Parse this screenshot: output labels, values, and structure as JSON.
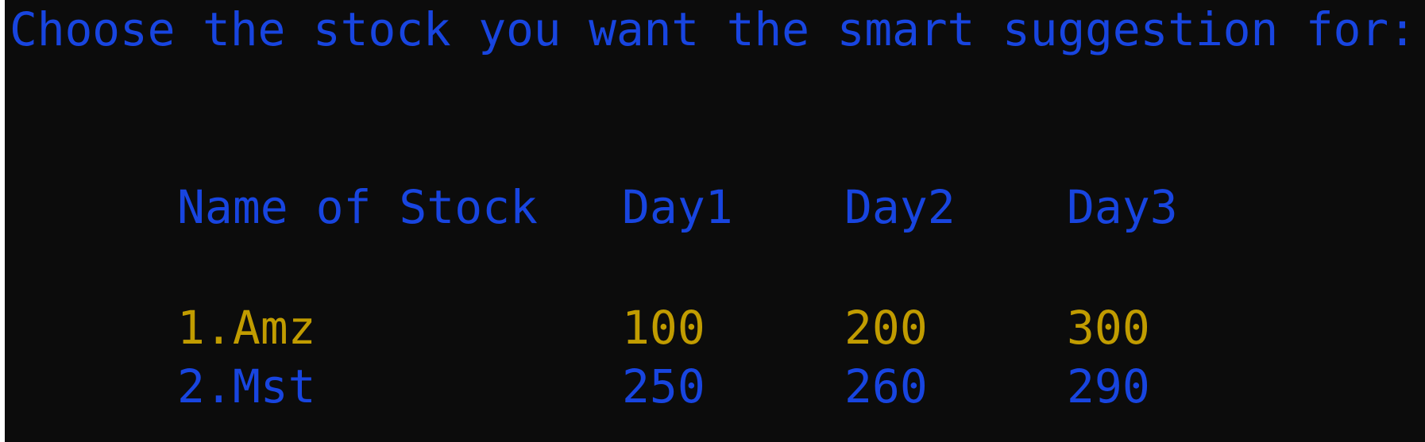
{
  "prompt": "Choose the stock you want the smart suggestion for:",
  "table": {
    "headers": [
      "Name of Stock",
      "Day1",
      "Day2",
      "Day3"
    ],
    "rows": [
      {
        "name": "1.Amz",
        "day1": "100",
        "day2": "200",
        "day3": "300",
        "color": "#c19c00"
      },
      {
        "name": "2.Mst",
        "day1": "250",
        "day2": "260",
        "day3": "290",
        "color": "#1845e0"
      }
    ]
  },
  "colors": {
    "background": "#0c0c0c",
    "text_blue": "#1845e0",
    "text_gold": "#c19c00"
  }
}
